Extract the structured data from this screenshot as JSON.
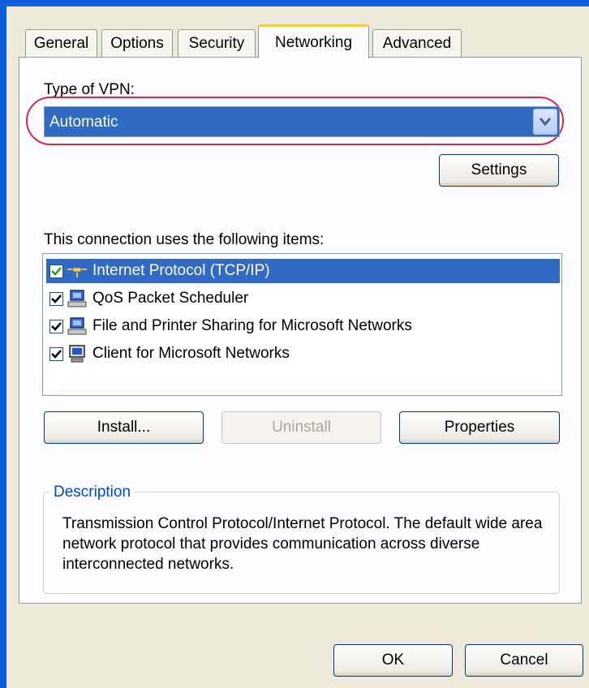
{
  "tabs": [
    {
      "label": "General"
    },
    {
      "label": "Options"
    },
    {
      "label": "Security"
    },
    {
      "label": "Networking"
    },
    {
      "label": "Advanced"
    }
  ],
  "active_tab": "Networking",
  "vpn": {
    "label": "Type of VPN:",
    "selected": "Automatic",
    "settings_button": "Settings"
  },
  "items": {
    "label": "This connection uses the following items:",
    "list": [
      {
        "label": "Internet Protocol (TCP/IP)",
        "checked": true,
        "selected": true,
        "icon": "network-protocol-icon"
      },
      {
        "label": "QoS Packet Scheduler",
        "checked": true,
        "selected": false,
        "icon": "computer-service-icon"
      },
      {
        "label": "File and Printer Sharing for Microsoft Networks",
        "checked": true,
        "selected": false,
        "icon": "computer-service-icon"
      },
      {
        "label": "Client for Microsoft Networks",
        "checked": true,
        "selected": false,
        "icon": "computer-client-icon"
      }
    ],
    "install_button": "Install...",
    "uninstall_button": "Uninstall",
    "properties_button": "Properties"
  },
  "description": {
    "legend": "Description",
    "text": "Transmission Control Protocol/Internet Protocol. The default wide area network protocol that provides communication across diverse interconnected networks."
  },
  "footer": {
    "ok_button": "OK",
    "cancel_button": "Cancel"
  },
  "colors": {
    "selection": "#316ac5",
    "highlight_ring": "#d42a4a",
    "active_tab_accent": "#ffc83c",
    "group_legend": "#0046d5"
  }
}
